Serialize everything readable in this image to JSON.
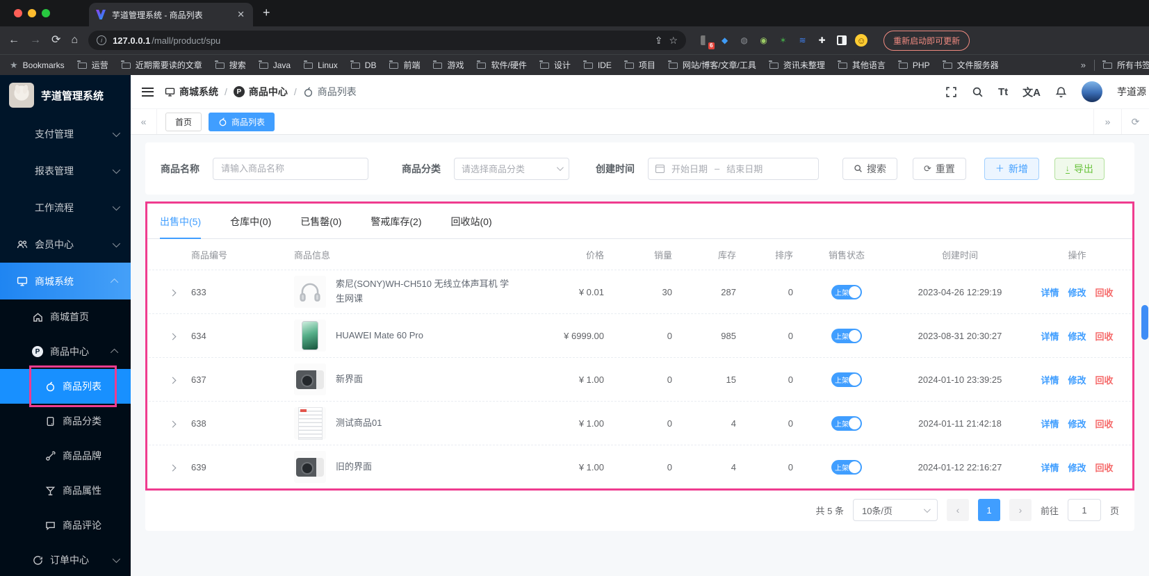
{
  "browser": {
    "tab_title": "芋道管理系统 - 商品列表",
    "close_glyph": "✕",
    "new_tab_glyph": "+",
    "url_domain": "127.0.0.1",
    "url_path": "/mall/product/spu",
    "restart_label": "重新启动即可更新",
    "ext_badge": "6",
    "bookmarks_label": "Bookmarks",
    "folders": [
      "运营",
      "近期需要读的文章",
      "搜索",
      "Java",
      "Linux",
      "DB",
      "前端",
      "游戏",
      "软件/硬件",
      "设计",
      "IDE",
      "项目",
      "网站/博客/文章/工具",
      "资讯未整理",
      "其他语言",
      "PHP",
      "文件服务器"
    ],
    "overflow": "»",
    "all_bookmarks": "所有书签"
  },
  "sidebar": {
    "logo_title": "芋道管理系统",
    "payment": "支付管理",
    "report": "报表管理",
    "workflow": "工作流程",
    "member": "会员中心",
    "mall": "商城系统",
    "mall_home": "商城首页",
    "product_center": "商品中心",
    "product_list": "商品列表",
    "product_category": "商品分类",
    "product_brand": "商品品牌",
    "product_attr": "商品属性",
    "product_comment": "商品评论",
    "order_center": "订单中心"
  },
  "header": {
    "breadcrumb": [
      "商城系统",
      "商品中心",
      "商品列表"
    ],
    "font_icon": "Tt",
    "lang_icon": "文A",
    "username": "芋道源"
  },
  "tags": {
    "home": "首页",
    "current": "商品列表"
  },
  "filters": {
    "name_label": "商品名称",
    "name_placeholder": "请输入商品名称",
    "category_label": "商品分类",
    "category_placeholder": "请选择商品分类",
    "date_label": "创建时间",
    "date_start": "开始日期",
    "date_sep": "–",
    "date_end": "结束日期",
    "search": "搜索",
    "reset": "重置",
    "add": "新增",
    "export": "导出"
  },
  "tabs": [
    "出售中(5)",
    "仓库中(0)",
    "已售罄(0)",
    "警戒库存(2)",
    "回收站(0)"
  ],
  "table": {
    "headers": [
      "商品编号",
      "商品信息",
      "价格",
      "销量",
      "库存",
      "排序",
      "销售状态",
      "创建时间",
      "操作"
    ],
    "actions": [
      "详情",
      "修改",
      "回收"
    ],
    "rows": [
      {
        "id": "633",
        "name": "索尼(SONY)WH-CH510 无线立体声耳机 学生网课",
        "price": "¥ 0.01",
        "sales": "30",
        "stock": "287",
        "sort": "0",
        "status": "上架",
        "created": "2023-04-26 12:29:19"
      },
      {
        "id": "634",
        "name": "HUAWEI Mate 60 Pro",
        "price": "¥ 6999.00",
        "sales": "0",
        "stock": "985",
        "sort": "0",
        "status": "上架",
        "created": "2023-08-31 20:30:27"
      },
      {
        "id": "637",
        "name": "新界面",
        "price": "¥ 1.00",
        "sales": "0",
        "stock": "15",
        "sort": "0",
        "status": "上架",
        "created": "2024-01-10 23:39:25"
      },
      {
        "id": "638",
        "name": "测试商品01",
        "price": "¥ 1.00",
        "sales": "0",
        "stock": "4",
        "sort": "0",
        "status": "上架",
        "created": "2024-01-11 21:42:18"
      },
      {
        "id": "639",
        "name": "旧的界面",
        "price": "¥ 1.00",
        "sales": "0",
        "stock": "4",
        "sort": "0",
        "status": "上架",
        "created": "2024-01-12 22:16:27"
      }
    ]
  },
  "pagination": {
    "total": "共 5 条",
    "size": "10条/页",
    "prev": "‹",
    "page": "1",
    "next": "›",
    "goto_label": "前往",
    "goto_value": "1",
    "unit": "页"
  },
  "colors": {
    "accent_blue": "#409eff",
    "sidebar_bg": "#001529",
    "annotation_pink": "#ef3c8f",
    "success_green": "#67c23a",
    "danger_red": "#f56c6c",
    "restart_salmon": "#ef8a80"
  }
}
